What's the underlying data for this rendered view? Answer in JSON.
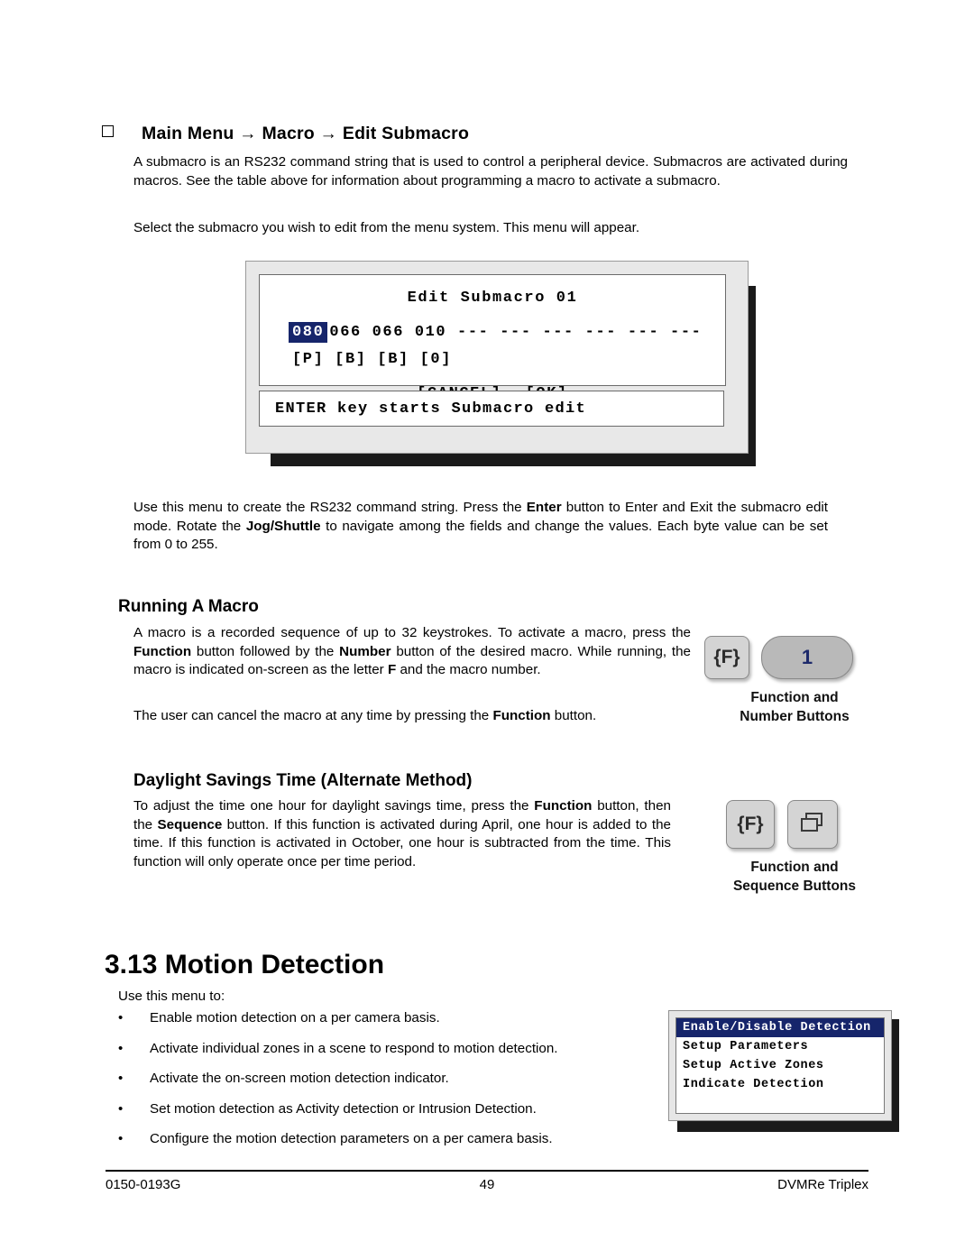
{
  "section": {
    "heading_prefix": "Main Menu",
    "arrow": " → ",
    "heading_mid": "Macro",
    "heading_end": "Edit Submacro",
    "paragraph1": "A submacro is an RS232 command string that is used to control a peripheral device.  Submacros are activated during macros.  See the table above for information about programming a macro to activate a submacro.",
    "paragraph2": "Select the submacro you wish to edit from the menu system.  This menu will appear."
  },
  "osd": {
    "title": "Edit Submacro 01",
    "byte_selected": "080",
    "bytes_rest": "066 066 010 --- --- --- --- --- ---",
    "chars": "[P] [B] [B] [0]",
    "cancel_label": "[CANCEL]",
    "ok_label": "[OK]",
    "status": "ENTER key starts Submacro edit"
  },
  "after_osd": {
    "text_a": "Use this menu to create the RS232 command string.  Press the ",
    "bold_enter": "Enter",
    "text_b": " button to Enter and Exit the submacro edit mode.  Rotate the ",
    "bold_jog": "Jog/Shuttle",
    "text_c": " to navigate among the fields and change the values.  Each byte value can be set from 0 to 255."
  },
  "running_macro": {
    "heading": "Running A Macro",
    "p1_a": "A macro is a recorded sequence of up to 32 keystrokes.  To activate a macro, press the ",
    "p1_bold1": "Function",
    "p1_b": " button followed by the ",
    "p1_bold2": "Number",
    "p1_c": " button of the desired macro.  While running, the macro is indicated on-screen as the letter ",
    "p1_bold3": "F",
    "p1_d": " and the macro number.",
    "p2_a": "The user can cancel the macro at any time by pressing the ",
    "p2_bold": "Function",
    "p2_b": " button."
  },
  "keys": {
    "function_label": "{F}",
    "number_label": "1",
    "caption_function_number_line1": "Function and",
    "caption_function_number_line2": "Number Buttons",
    "function_label_2": "{F}",
    "caption_function_sequence_line1": "Function and",
    "caption_function_sequence_line2": "Sequence Buttons"
  },
  "dst": {
    "heading": "Daylight Savings Time (Alternate Method)",
    "p_a": "To adjust the time one hour for daylight savings time, press the ",
    "p_bold1": "Function",
    "p_b": " button, then the ",
    "p_bold2": "Sequence",
    "p_c": " button.  If this function is activated during April, one hour is added to the time.  If this function is activated in October, one hour is subtracted from the time.  This function will only operate once per time period."
  },
  "motion": {
    "heading": "3.13 Motion Detection",
    "intro": "Use this menu to:",
    "bullets": [
      "Enable motion detection on a per camera basis.",
      "Activate individual zones in a scene to respond to motion detection.",
      "Activate the on-screen motion detection indicator.",
      "Set motion detection as Activity detection or Intrusion Detection.",
      "Configure the motion detection parameters on a per camera basis."
    ],
    "menu": [
      "Enable/Disable Detection",
      "Setup Parameters",
      "Setup Active Zones",
      "Indicate Detection"
    ]
  },
  "footer": {
    "left": "0150-0193G",
    "center": "49",
    "right": "DVMRe Triplex"
  }
}
